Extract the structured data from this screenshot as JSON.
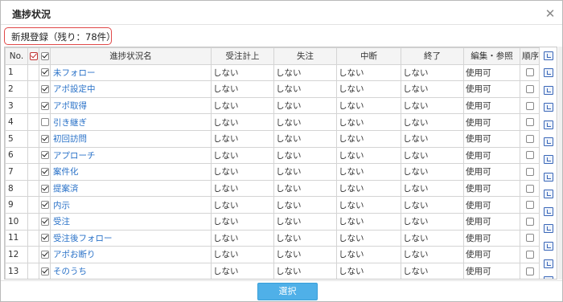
{
  "dialog": {
    "title": "進捗状況",
    "close_glyph": "✕"
  },
  "new_registration": "新規登録（残り：78件）",
  "table": {
    "headers": {
      "no": "No.",
      "name": "進捗状況名",
      "col1": "受注計上",
      "col2": "失注",
      "col3": "中断",
      "col4": "終了",
      "col5": "編集・参照",
      "col6": "順序"
    },
    "header_checks": {
      "red": true,
      "black": true
    },
    "rows": [
      {
        "no": "1",
        "checked": true,
        "name": "未フォロー",
        "c1": "しない",
        "c2": "しない",
        "c3": "しない",
        "c4": "しない",
        "c5": "使用可"
      },
      {
        "no": "2",
        "checked": true,
        "name": "アポ設定中",
        "c1": "しない",
        "c2": "しない",
        "c3": "しない",
        "c4": "しない",
        "c5": "使用可"
      },
      {
        "no": "3",
        "checked": true,
        "name": "アポ取得",
        "c1": "しない",
        "c2": "しない",
        "c3": "しない",
        "c4": "しない",
        "c5": "使用可"
      },
      {
        "no": "4",
        "checked": false,
        "name": "引き継ぎ",
        "c1": "しない",
        "c2": "しない",
        "c3": "しない",
        "c4": "しない",
        "c5": "使用可"
      },
      {
        "no": "5",
        "checked": true,
        "name": "初回訪問",
        "c1": "しない",
        "c2": "しない",
        "c3": "しない",
        "c4": "しない",
        "c5": "使用可"
      },
      {
        "no": "6",
        "checked": true,
        "name": "アプローチ",
        "c1": "しない",
        "c2": "しない",
        "c3": "しない",
        "c4": "しない",
        "c5": "使用可"
      },
      {
        "no": "7",
        "checked": true,
        "name": "案件化",
        "c1": "しない",
        "c2": "しない",
        "c3": "しない",
        "c4": "しない",
        "c5": "使用可"
      },
      {
        "no": "8",
        "checked": true,
        "name": "提案済",
        "c1": "しない",
        "c2": "しない",
        "c3": "しない",
        "c4": "しない",
        "c5": "使用可"
      },
      {
        "no": "9",
        "checked": true,
        "name": "内示",
        "c1": "しない",
        "c2": "しない",
        "c3": "しない",
        "c4": "しない",
        "c5": "使用可"
      },
      {
        "no": "10",
        "checked": true,
        "name": "受注",
        "c1": "しない",
        "c2": "しない",
        "c3": "しない",
        "c4": "しない",
        "c5": "使用可"
      },
      {
        "no": "11",
        "checked": true,
        "name": "受注後フォロー",
        "c1": "しない",
        "c2": "しない",
        "c3": "しない",
        "c4": "しない",
        "c5": "使用可"
      },
      {
        "no": "12",
        "checked": true,
        "name": "アポお断り",
        "c1": "しない",
        "c2": "しない",
        "c3": "しない",
        "c4": "しない",
        "c5": "使用可"
      },
      {
        "no": "13",
        "checked": true,
        "name": "そのうち",
        "c1": "しない",
        "c2": "しない",
        "c3": "しない",
        "c4": "しない",
        "c5": "使用可"
      }
    ]
  },
  "icons": {
    "close": "close-icon",
    "edit": "edit-icon",
    "checkbox": "checkbox-icon"
  },
  "colors": {
    "link": "#2a72c8",
    "select_button": "#4fb0e8",
    "highlight_border": "#e04848"
  },
  "footer": {
    "select_label": "選択"
  }
}
